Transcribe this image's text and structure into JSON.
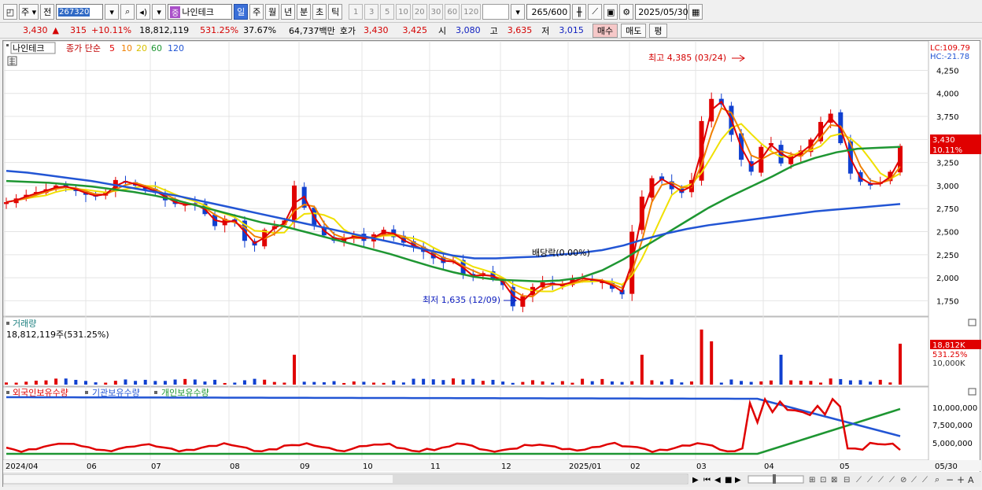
{
  "toolbar": {
    "period_type": "주",
    "prev_label": "전",
    "code": "267320",
    "name_tag": "중",
    "stock_name": "나인테크",
    "timeframes": [
      "일",
      "주",
      "월",
      "년",
      "분",
      "초",
      "틱"
    ],
    "active_timeframe": "일",
    "intervals": [
      "1",
      "3",
      "5",
      "10",
      "20",
      "30",
      "60",
      "120"
    ],
    "count": "265",
    "count_total": "/600",
    "date": "2025/05/30"
  },
  "quote": {
    "price": "3,430",
    "change_arrow": "▲",
    "change": "315",
    "change_pct": "+10.11%",
    "volume": "18,812,119",
    "volume_ratio": "531.25%",
    "turnover": "37.67%",
    "amount": "64,737백만",
    "bid_ask_label": "호가",
    "ask": "3,430",
    "bid": "3,425",
    "open_label": "시",
    "open": "3,080",
    "high_label": "고",
    "high": "3,635",
    "low_label": "저",
    "low": "3,015",
    "buy_label": "매수",
    "sell_label": "매도",
    "eval_label": "평"
  },
  "price_panel": {
    "stock_legend": "나인테크",
    "ma_legend_prefix": "종가 단순",
    "ma_periods": [
      "5",
      "10",
      "20",
      "60",
      "120"
    ],
    "lc": "LC:109.79",
    "hc": "HC:-21.78",
    "current_price_label": "3,430",
    "current_pct_label": "10.11%",
    "high_annotation": "최고 4,385 (03/24)",
    "low_annotation": "최저 1,635 (12/09)",
    "dividend_annotation": "배당락(0.00%)"
  },
  "volume_panel": {
    "title": "거래량",
    "value_label": "18,812,119주(531.25%)",
    "current_label": "18,812K",
    "current_pct_label": "531.25%",
    "axis_tick": "10,000K"
  },
  "holdings_panel": {
    "legend": [
      "외국인보유수량",
      "기관보유수량",
      "개인보유수량"
    ],
    "axis_ticks": [
      "10,000,000",
      "7,500,000",
      "5,000,000"
    ]
  },
  "date_axis": {
    "labels": [
      "2024/04",
      "06",
      "07",
      "08",
      "09",
      "10",
      "11",
      "12",
      "2025/01",
      "02",
      "03",
      "04",
      "05"
    ],
    "end_label": "05/30"
  },
  "chart_data": {
    "type": "candlestick",
    "price_axis": {
      "ticks": [
        4250,
        4000,
        3750,
        3500,
        3250,
        3000,
        2750,
        2500,
        2250,
        2000,
        1750
      ],
      "range": [
        1600,
        4450
      ]
    },
    "price_series": {
      "close": [
        2820,
        2860,
        2900,
        2930,
        2960,
        3000,
        2980,
        2940,
        2900,
        2880,
        2930,
        3060,
        3030,
        3000,
        2960,
        2920,
        2840,
        2800,
        2790,
        2800,
        2690,
        2560,
        2640,
        2600,
        2400,
        2350,
        2520,
        2560,
        2620,
        3000,
        2760,
        2560,
        2460,
        2400,
        2430,
        2460,
        2400,
        2470,
        2520,
        2440,
        2380,
        2330,
        2280,
        2210,
        2160,
        2190,
        2030,
        2010,
        2050,
        1990,
        1920,
        1690,
        1800,
        1900,
        1950,
        1920,
        1920,
        1990,
        2000,
        1960,
        1960,
        1880,
        1820,
        2500,
        2880,
        3080,
        3060,
        2960,
        2920,
        3060,
        3700,
        3940,
        3880,
        3550,
        3280,
        3150,
        3420,
        3460,
        3240,
        3330,
        3380,
        3500,
        3690,
        3780,
        3460,
        3130,
        3040,
        3000,
        3040,
        3150,
        3430
      ],
      "ma20": [
        2700,
        2760,
        2800,
        2860,
        2900,
        2930,
        2920,
        2880,
        2850,
        2830,
        2840,
        2850,
        2880,
        2880,
        2800,
        2720,
        2690,
        2660,
        2570,
        2520,
        2430,
        2500,
        2540,
        2600,
        2610,
        2620,
        2550,
        2490,
        2450,
        2390,
        2320,
        2280,
        2180,
        2120,
        2070,
        2050,
        2020,
        1980,
        1950,
        1900,
        1920,
        1960,
        1980,
        1960,
        1950,
        1970,
        1960,
        1980,
        1990,
        1990,
        2040,
        2110,
        2260,
        2460,
        2600,
        2700,
        2820,
        2850,
        2880,
        3000,
        3150,
        3330,
        3470,
        3500,
        3480,
        3400,
        3360,
        3360,
        3400,
        3430,
        3460,
        3480,
        3480,
        3460,
        3440,
        3400,
        3400,
        3420
      ]
    },
    "ma_series": [
      {
        "name": "60",
        "color": "#1e9632"
      },
      {
        "name": "120",
        "color": "#2255d4"
      }
    ],
    "volume": {
      "axis_ticks": [
        10000
      ],
      "unit": "K",
      "last": 18812
    },
    "holdings": {
      "axis_ticks": [
        10000000,
        7500000,
        5000000
      ]
    }
  }
}
